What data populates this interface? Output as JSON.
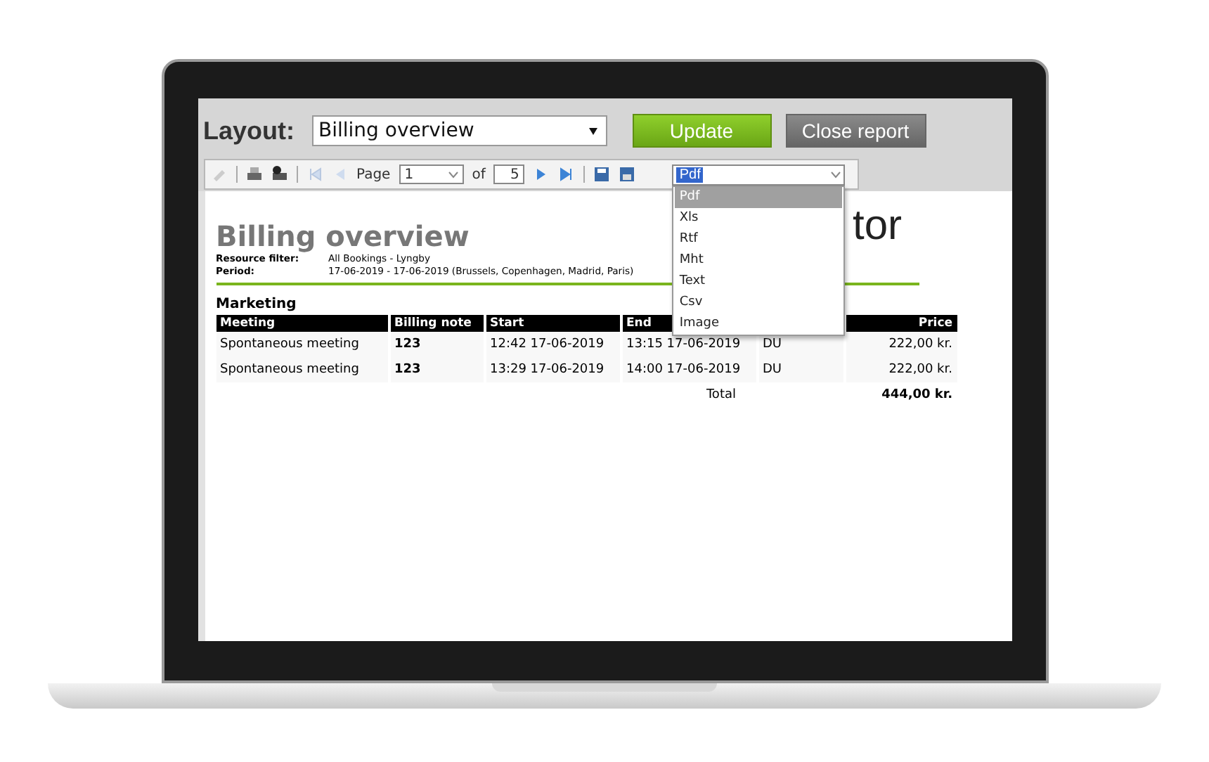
{
  "layout_bar": {
    "label": "Layout:",
    "layout_select": "Billing overview",
    "buttons": [
      {
        "label": "Update",
        "kind": "primary"
      },
      {
        "label": "Close report",
        "kind": "secondary"
      }
    ]
  },
  "toolbar": {
    "page_label": "Page",
    "page": "1",
    "of_label": "of",
    "page_count": "5",
    "format": "Pdf"
  },
  "format_menu": [
    {
      "label": "Pdf",
      "selected": true
    },
    {
      "label": "Xls",
      "selected": false
    },
    {
      "label": "Rtf",
      "selected": false
    },
    {
      "label": "Mht",
      "selected": false
    },
    {
      "label": "Text",
      "selected": false
    },
    {
      "label": "Csv",
      "selected": false
    },
    {
      "label": "Image",
      "selected": false
    }
  ],
  "report": {
    "title": "Billing overview",
    "logo_text": "tor",
    "filters": [
      {
        "label": "Resource filter:",
        "value": "All Bookings - Lyngby"
      },
      {
        "label": "Period:",
        "value": "17-06-2019 - 17-06-2019 (Brussels, Copenhagen, Madrid, Paris)"
      }
    ],
    "group": "Marketing",
    "columns": [
      "Meeting",
      "Billing note",
      "Start",
      "End",
      null,
      "Price"
    ],
    "rows": [
      [
        "Spontaneous meeting",
        "123",
        "12:42 17-06-2019",
        "13:15 17-06-2019",
        "DU",
        "222,00 kr."
      ],
      [
        "Spontaneous meeting",
        "123",
        "13:29 17-06-2019",
        "14:00 17-06-2019",
        "DU",
        "222,00 kr."
      ]
    ],
    "total": {
      "label": "Total",
      "value": "444,00 kr."
    }
  }
}
